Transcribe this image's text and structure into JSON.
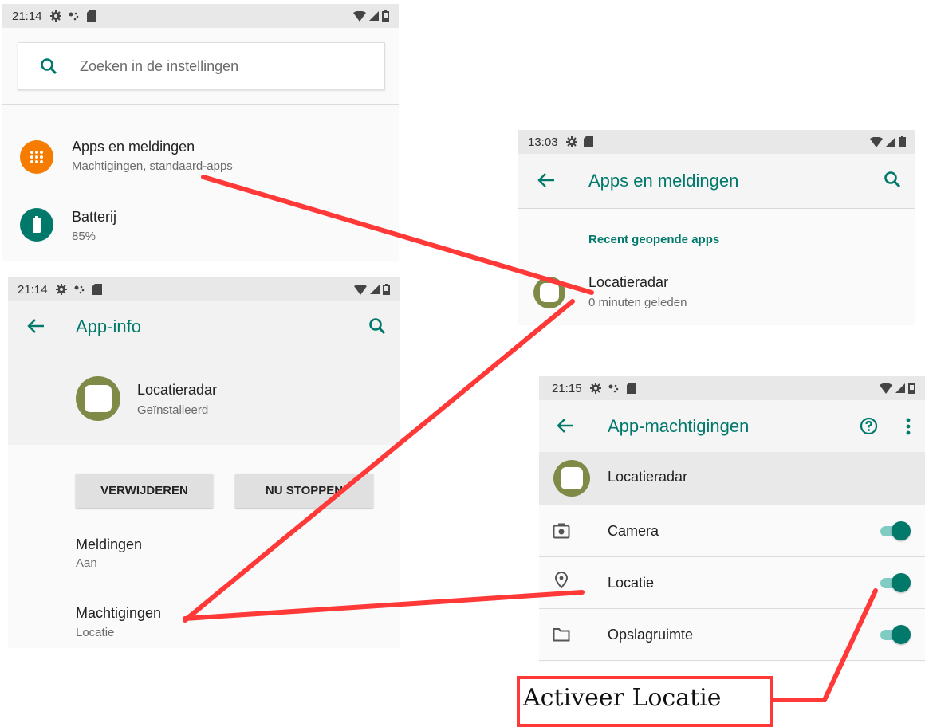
{
  "panel_settings": {
    "status": {
      "time": "21:14"
    },
    "search": {
      "placeholder": "Zoeken in de instellingen"
    },
    "items": [
      {
        "title": "Apps en meldingen",
        "subtitle": "Machtigingen, standaard-apps"
      },
      {
        "title": "Batterij",
        "subtitle": "85%"
      }
    ]
  },
  "panel_apps": {
    "status": {
      "time": "13:03"
    },
    "title": "Apps en meldingen",
    "section": "Recent geopende apps",
    "app": {
      "name": "Locatieradar",
      "subtitle": "0 minuten geleden"
    }
  },
  "panel_appinfo": {
    "status": {
      "time": "21:14"
    },
    "title": "App-info",
    "app": {
      "name": "Locatieradar",
      "status": "Geïnstalleerd"
    },
    "buttons": {
      "uninstall": "VERWIJDEREN",
      "stop": "NU STOPPEN"
    },
    "items": [
      {
        "title": "Meldingen",
        "subtitle": "Aan"
      },
      {
        "title": "Machtigingen",
        "subtitle": "Locatie"
      }
    ]
  },
  "panel_permissions": {
    "status": {
      "time": "21:15"
    },
    "title": "App-machtigingen",
    "app_name": "Locatieradar",
    "permissions": [
      {
        "label": "Camera",
        "enabled": true,
        "icon": "camera-icon"
      },
      {
        "label": "Locatie",
        "enabled": true,
        "icon": "location-pin-icon"
      },
      {
        "label": "Opslagruimte",
        "enabled": true,
        "icon": "folder-icon"
      }
    ]
  },
  "annotation": {
    "label": "Activeer Locatie",
    "color": "#ff3838"
  },
  "colors": {
    "accent": "#00796b",
    "orange": "#f57c00",
    "battery": "#00796b",
    "app_icon": "#7f8a47"
  }
}
